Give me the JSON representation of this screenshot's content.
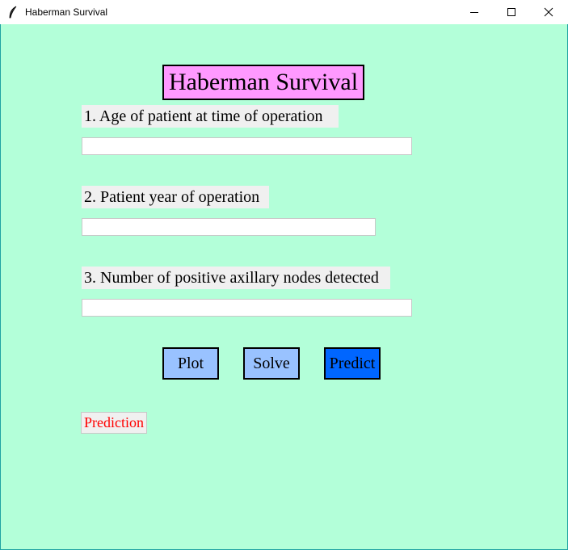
{
  "window": {
    "title": "Haberman Survival",
    "icon": "feather-icon",
    "controls": [
      "minimize-icon",
      "maximize-icon",
      "close-icon"
    ]
  },
  "app": {
    "heading": "Haberman Survival",
    "fields": [
      {
        "label": "1. Age of patient at time of operation",
        "value": ""
      },
      {
        "label": "2. Patient year of operation",
        "value": ""
      },
      {
        "label": "3. Number of positive axillary nodes detected",
        "value": ""
      }
    ],
    "buttons": {
      "plot": "Plot",
      "solve": "Solve",
      "predict": "Predict"
    },
    "result_label": "Prediction"
  },
  "colors": {
    "background": "#b3ffd9",
    "heading_bg": "#ff99ff",
    "label_bg": "#f0f0f0",
    "plot_button": "#99c2ff",
    "solve_button": "#99c2ff",
    "predict_button": "#0066ff",
    "result_text": "#ff0000"
  }
}
